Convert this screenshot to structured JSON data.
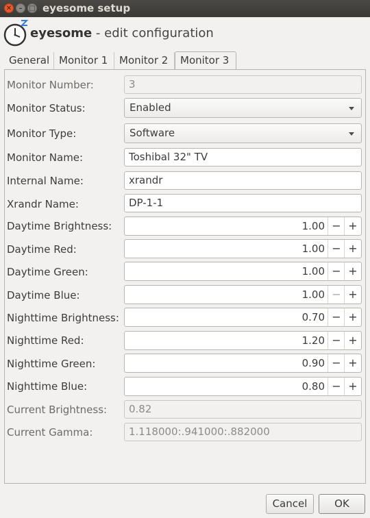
{
  "window": {
    "title": "eyesome setup",
    "close_glyph": "✕",
    "min_glyph": "–",
    "max_glyph": "□"
  },
  "header": {
    "app_name": "eyesome",
    "subtitle": " - edit configuration",
    "logo_icon": "clock-moon-icon"
  },
  "tabs": [
    {
      "label": "General",
      "active": false
    },
    {
      "label": "Monitor 1",
      "active": false
    },
    {
      "label": "Monitor 2",
      "active": false
    },
    {
      "label": "Monitor 3",
      "active": true
    }
  ],
  "form": {
    "monitor_number": {
      "label": "Monitor Number:",
      "value": "3"
    },
    "monitor_status": {
      "label": "Monitor Status:",
      "value": "Enabled"
    },
    "monitor_type": {
      "label": "Monitor Type:",
      "value": "Software"
    },
    "monitor_name": {
      "label": "Monitor Name:",
      "value": "Toshibal 32\" TV"
    },
    "internal_name": {
      "label": "Internal Name:",
      "value": "xrandr"
    },
    "xrandr_name": {
      "label": "Xrandr Name:",
      "value": "DP-1-1"
    },
    "daytime_brightness": {
      "label": "Daytime Brightness:",
      "value": "1.00"
    },
    "daytime_red": {
      "label": "Daytime Red:",
      "value": "1.00"
    },
    "daytime_green": {
      "label": "Daytime Green:",
      "value": "1.00"
    },
    "daytime_blue": {
      "label": "Daytime Blue:",
      "value": "1.00"
    },
    "nighttime_brightness": {
      "label": "Nighttime Brightness:",
      "value": "0.70"
    },
    "nighttime_red": {
      "label": "Nighttime Red:",
      "value": "1.20"
    },
    "nighttime_green": {
      "label": "Nighttime Green:",
      "value": "0.90"
    },
    "nighttime_blue": {
      "label": "Nighttime Blue:",
      "value": "0.80"
    },
    "current_brightness": {
      "label": "Current Brightness:",
      "value": "0.82"
    },
    "current_gamma": {
      "label": "Current Gamma:",
      "value": "1.118000:.941000:.882000"
    }
  },
  "spin": {
    "minus": "−",
    "plus": "+"
  },
  "buttons": {
    "cancel": "Cancel",
    "ok": "OK"
  },
  "colors": {
    "close": "#e8592b",
    "titlebar": "#3c3b37",
    "background": "#f2f1f0"
  }
}
